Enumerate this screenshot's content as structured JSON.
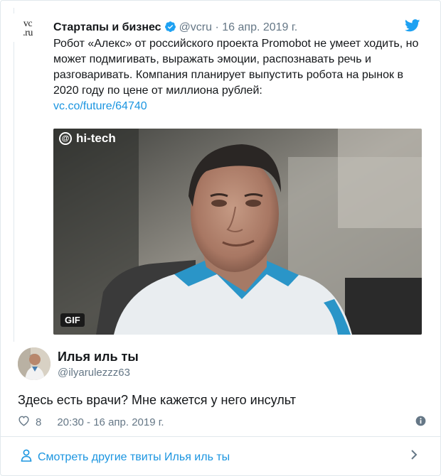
{
  "quoted_tweet": {
    "account_name": "Стартапы и бизнес",
    "handle": "@vcru",
    "separator": "·",
    "date": "16 апр. 2019 г.",
    "logo_top": "vc",
    "logo_bottom": ".ru",
    "text": "Робот «Алекс» от российского проекта Promobot не умеет ходить, но может подмигивать, выражать эмоции, распознавать речь и разговаривать. Компания планирует выпустить робота на рынок в 2020 году по цене от миллиона рублей:",
    "link": "vc.co/future/64740",
    "media": {
      "watermark": "hi-tech",
      "badge": "GIF"
    }
  },
  "tweet": {
    "user_name": "Илья иль ты",
    "handle": "@ilyarulezzz63",
    "text": "Здесь есть врачи? Мне кажется у него инсульт",
    "likes": "8",
    "timestamp": "20:30 - 16 апр. 2019 г."
  },
  "footer": {
    "more_tweets_label": "Смотреть другие твиты Илья иль ты"
  },
  "colors": {
    "link": "#1b95e0",
    "muted": "#657786",
    "text": "#14171a",
    "border": "#e1e8ed"
  },
  "icons": [
    "verified-badge-icon",
    "twitter-bird-icon",
    "heart-icon",
    "info-icon",
    "person-icon",
    "chevron-right-icon"
  ]
}
